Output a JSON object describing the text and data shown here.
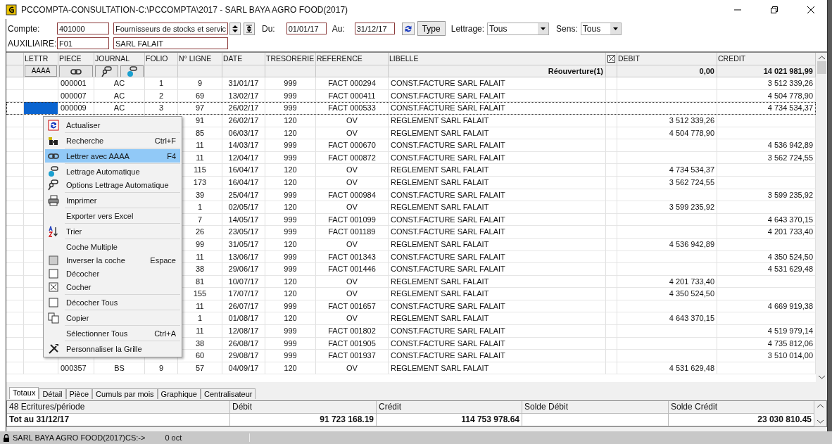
{
  "window": {
    "title": "PCCOMPTA-CONSULTATION-C:\\PCCOMPTA\\2017 - SARL BAYA AGRO FOOD(2017)"
  },
  "filters": {
    "compte_label": "Compte:",
    "compte": "401000",
    "compte_name": "Fournisseurs de stocks et servic",
    "du_label": "Du:",
    "du": "01/01/17",
    "au_label": "Au:",
    "au": "31/12/17",
    "type_button": "Type",
    "lettrage_label": "Lettrage:",
    "lettrage": "Tous",
    "sens_label": "Sens:",
    "sens": "Tous",
    "auxiliaire_label": "AUXILIAIRE:",
    "auxiliaire": "F01",
    "auxiliaire_name": "SARL FALAIT"
  },
  "table": {
    "columns": [
      "LETTR",
      "PIECE",
      "JOURNAL",
      "FOLIO",
      "N° LIGNE",
      "DATE",
      "TRESORERIE",
      "REFERENCE",
      "LIBELLE",
      "DEBIT",
      "CREDIT"
    ],
    "debit_checked": true,
    "filter_row": {
      "lettrage_button": "AAAA",
      "libelle": "Réouverture(1)",
      "debit": "0,00",
      "credit": "14 021 981,99"
    },
    "rows": [
      {
        "piece": "000001",
        "journal": "AC",
        "folio": "1",
        "ligne": "9",
        "date": "31/01/17",
        "tresorerie": "999",
        "reference": "FACT 000294",
        "libelle": "CONST.FACTURE SARL FALAIT",
        "credit": "3 512 339,26",
        "selected": false
      },
      {
        "piece": "000007",
        "journal": "AC",
        "folio": "2",
        "ligne": "69",
        "date": "13/02/17",
        "tresorerie": "999",
        "reference": "FACT 000411",
        "libelle": "CONST.FACTURE SARL FALAIT",
        "credit": "4 504 778,90",
        "selected": false
      },
      {
        "piece": "000009",
        "journal": "AC",
        "folio": "3",
        "ligne": "97",
        "date": "26/02/17",
        "tresorerie": "999",
        "reference": "FACT 000533",
        "libelle": "CONST.FACTURE SARL FALAIT",
        "credit": "4 734 534,37",
        "selected": true
      },
      {
        "ligne": "91",
        "date": "26/02/17",
        "tresorerie": "120",
        "reference": "OV",
        "libelle": "REGLEMENT SARL FALAIT",
        "debit": "3 512 339,26",
        "selected": false
      },
      {
        "ligne": "85",
        "date": "06/03/17",
        "tresorerie": "120",
        "reference": "OV",
        "libelle": "REGLEMENT SARL FALAIT",
        "debit": "4 504 778,90",
        "selected": false
      },
      {
        "ligne": "11",
        "date": "14/03/17",
        "tresorerie": "999",
        "reference": "FACT 000670",
        "libelle": "CONST.FACTURE SARL FALAIT",
        "credit": "4 536 942,89",
        "selected": false
      },
      {
        "ligne": "11",
        "date": "12/04/17",
        "tresorerie": "999",
        "reference": "FACT 000872",
        "libelle": "CONST.FACTURE SARL FALAIT",
        "credit": "3 562 724,55",
        "selected": false
      },
      {
        "ligne": "115",
        "date": "16/04/17",
        "tresorerie": "120",
        "reference": "OV",
        "libelle": "REGLEMENT SARL FALAIT",
        "debit": "4 734 534,37",
        "selected": false
      },
      {
        "ligne": "173",
        "date": "16/04/17",
        "tresorerie": "120",
        "reference": "OV",
        "libelle": "REGLEMENT SARL FALAIT",
        "debit": "3 562 724,55",
        "selected": false
      },
      {
        "ligne": "39",
        "date": "25/04/17",
        "tresorerie": "999",
        "reference": "FACT 000984",
        "libelle": "CONST.FACTURE SARL FALAIT",
        "credit": "3 599 235,92",
        "selected": false
      },
      {
        "ligne": "1",
        "date": "02/05/17",
        "tresorerie": "120",
        "reference": "OV",
        "libelle": "REGLEMENT SARL FALAIT",
        "debit": "3 599 235,92",
        "selected": false
      },
      {
        "ligne": "7",
        "date": "14/05/17",
        "tresorerie": "999",
        "reference": "FACT 001099",
        "libelle": "CONST.FACTURE SARL FALAIT",
        "credit": "4 643 370,15",
        "selected": false
      },
      {
        "ligne": "26",
        "date": "23/05/17",
        "tresorerie": "999",
        "reference": "FACT 001189",
        "libelle": "CONST.FACTURE SARL FALAIT",
        "credit": "4 201 733,40",
        "selected": false
      },
      {
        "ligne": "99",
        "date": "31/05/17",
        "tresorerie": "120",
        "reference": "OV",
        "libelle": "REGLEMENT SARL FALAIT",
        "debit": "4 536 942,89",
        "selected": false
      },
      {
        "ligne": "11",
        "date": "13/06/17",
        "tresorerie": "999",
        "reference": "FACT 001343",
        "libelle": "CONST.FACTURE SARL FALAIT",
        "credit": "4 350 524,50",
        "selected": false
      },
      {
        "ligne": "38",
        "date": "29/06/17",
        "tresorerie": "999",
        "reference": "FACT 001446",
        "libelle": "CONST.FACTURE SARL FALAIT",
        "credit": "4 531 629,48",
        "selected": false
      },
      {
        "ligne": "81",
        "date": "10/07/17",
        "tresorerie": "120",
        "reference": "OV",
        "libelle": "REGLEMENT SARL FALAIT",
        "debit": "4 201 733,40",
        "selected": false
      },
      {
        "ligne": "155",
        "date": "17/07/17",
        "tresorerie": "120",
        "reference": "OV",
        "libelle": "REGLEMENT SARL FALAIT",
        "debit": "4 350 524,50",
        "selected": false
      },
      {
        "ligne": "11",
        "date": "26/07/17",
        "tresorerie": "999",
        "reference": "FACT 001657",
        "libelle": "CONST.FACTURE SARL FALAIT",
        "credit": "4 669 919,38",
        "selected": false
      },
      {
        "ligne": "1",
        "date": "01/08/17",
        "tresorerie": "120",
        "reference": "OV",
        "libelle": "REGLEMENT SARL FALAIT",
        "debit": "4 643 370,15",
        "selected": false
      },
      {
        "ligne": "11",
        "date": "12/08/17",
        "tresorerie": "999",
        "reference": "FACT 001802",
        "libelle": "CONST.FACTURE SARL FALAIT",
        "credit": "4 519 979,14",
        "selected": false
      },
      {
        "ligne": "38",
        "date": "26/08/17",
        "tresorerie": "999",
        "reference": "FACT 001905",
        "libelle": "CONST.FACTURE SARL FALAIT",
        "credit": "4 735 812,06",
        "selected": false
      },
      {
        "ligne": "60",
        "date": "29/08/17",
        "tresorerie": "999",
        "reference": "FACT 001937",
        "libelle": "CONST.FACTURE SARL FALAIT",
        "credit": "3 510 014,00",
        "selected": false
      },
      {
        "piece": "000357",
        "journal": "BS",
        "folio": "9",
        "ligne": "57",
        "date": "04/09/17",
        "tresorerie": "120",
        "reference": "OV",
        "libelle": "REGLEMENT SARL FALAIT",
        "debit": "4 531 629,48",
        "selected": false
      }
    ]
  },
  "context_menu": {
    "items": [
      {
        "kind": "item",
        "label": "Actualiser",
        "selected": false
      },
      {
        "kind": "separator"
      },
      {
        "kind": "item",
        "label": "Recherche",
        "shortcut": "Ctrl+F",
        "selected": false
      },
      {
        "kind": "separator"
      },
      {
        "kind": "item",
        "label": "Lettrer avec AAAA",
        "shortcut": "F4",
        "selected": true
      },
      {
        "kind": "separator"
      },
      {
        "kind": "item",
        "label": "Lettrage Automatique",
        "selected": false
      },
      {
        "kind": "item",
        "label": "Options Lettrage Automatique",
        "selected": false
      },
      {
        "kind": "separator"
      },
      {
        "kind": "item",
        "label": "Imprimer",
        "selected": false
      },
      {
        "kind": "separator"
      },
      {
        "kind": "item",
        "label": "Exporter vers Excel",
        "selected": false
      },
      {
        "kind": "separator"
      },
      {
        "kind": "item",
        "label": "Trier",
        "selected": false
      },
      {
        "kind": "separator"
      },
      {
        "kind": "item",
        "label": "Coche Multiple",
        "selected": false
      },
      {
        "kind": "item",
        "label": "Inverser la coche",
        "shortcut": "Espace",
        "selected": false
      },
      {
        "kind": "item",
        "label": "Décocher",
        "selected": false
      },
      {
        "kind": "item",
        "label": "Cocher",
        "selected": false
      },
      {
        "kind": "separator"
      },
      {
        "kind": "item",
        "label": "Décocher Tous",
        "selected": false
      },
      {
        "kind": "separator"
      },
      {
        "kind": "item",
        "label": "Copier",
        "selected": false
      },
      {
        "kind": "separator"
      },
      {
        "kind": "item",
        "label": "Sélectionner Tous",
        "shortcut": "Ctrl+A",
        "selected": false
      },
      {
        "kind": "separator"
      },
      {
        "kind": "item",
        "label": "Personnaliser la Grille",
        "selected": false
      }
    ]
  },
  "tabs": [
    {
      "label": "Totaux",
      "selected": true
    },
    {
      "label": "Détail",
      "selected": false
    },
    {
      "label": "Pièce",
      "selected": false
    },
    {
      "label": "Cumuls par mois",
      "selected": false
    },
    {
      "label": "Graphique",
      "selected": false
    },
    {
      "label": "Centralisateur",
      "selected": false
    }
  ],
  "totals": {
    "columns": [
      "48 Ecritures/période",
      "Débit",
      "Crédit",
      "Solde Débit",
      "Solde Crédit"
    ],
    "row": {
      "label": "Tot au 31/12/17",
      "debit": "91 723 168.19",
      "credit": "114 753 978.64",
      "solde_credit": "23 030 810.45"
    }
  },
  "status_bar": {
    "company": "SARL BAYA AGRO FOOD(2017)CS:->",
    "size": "0 oct"
  }
}
